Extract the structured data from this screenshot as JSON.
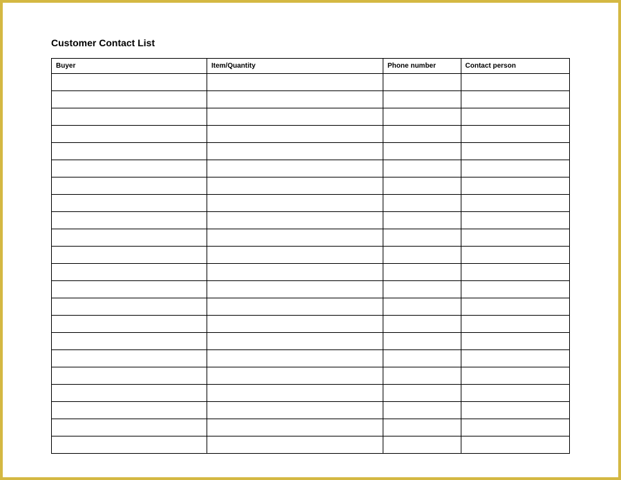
{
  "title": "Customer Contact List",
  "table": {
    "headers": {
      "buyer": "Buyer",
      "item_quantity": "Item/Quantity",
      "phone_number": "Phone number",
      "contact_person": "Contact person"
    },
    "rows": [
      {
        "buyer": "",
        "item_quantity": "",
        "phone_number": "",
        "contact_person": ""
      },
      {
        "buyer": "",
        "item_quantity": "",
        "phone_number": "",
        "contact_person": ""
      },
      {
        "buyer": "",
        "item_quantity": "",
        "phone_number": "",
        "contact_person": ""
      },
      {
        "buyer": "",
        "item_quantity": "",
        "phone_number": "",
        "contact_person": ""
      },
      {
        "buyer": "",
        "item_quantity": "",
        "phone_number": "",
        "contact_person": ""
      },
      {
        "buyer": "",
        "item_quantity": "",
        "phone_number": "",
        "contact_person": ""
      },
      {
        "buyer": "",
        "item_quantity": "",
        "phone_number": "",
        "contact_person": ""
      },
      {
        "buyer": "",
        "item_quantity": "",
        "phone_number": "",
        "contact_person": ""
      },
      {
        "buyer": "",
        "item_quantity": "",
        "phone_number": "",
        "contact_person": ""
      },
      {
        "buyer": "",
        "item_quantity": "",
        "phone_number": "",
        "contact_person": ""
      },
      {
        "buyer": "",
        "item_quantity": "",
        "phone_number": "",
        "contact_person": ""
      },
      {
        "buyer": "",
        "item_quantity": "",
        "phone_number": "",
        "contact_person": ""
      },
      {
        "buyer": "",
        "item_quantity": "",
        "phone_number": "",
        "contact_person": ""
      },
      {
        "buyer": "",
        "item_quantity": "",
        "phone_number": "",
        "contact_person": ""
      },
      {
        "buyer": "",
        "item_quantity": "",
        "phone_number": "",
        "contact_person": ""
      },
      {
        "buyer": "",
        "item_quantity": "",
        "phone_number": "",
        "contact_person": ""
      },
      {
        "buyer": "",
        "item_quantity": "",
        "phone_number": "",
        "contact_person": ""
      },
      {
        "buyer": "",
        "item_quantity": "",
        "phone_number": "",
        "contact_person": ""
      },
      {
        "buyer": "",
        "item_quantity": "",
        "phone_number": "",
        "contact_person": ""
      },
      {
        "buyer": "",
        "item_quantity": "",
        "phone_number": "",
        "contact_person": ""
      },
      {
        "buyer": "",
        "item_quantity": "",
        "phone_number": "",
        "contact_person": ""
      },
      {
        "buyer": "",
        "item_quantity": "",
        "phone_number": "",
        "contact_person": ""
      }
    ]
  }
}
